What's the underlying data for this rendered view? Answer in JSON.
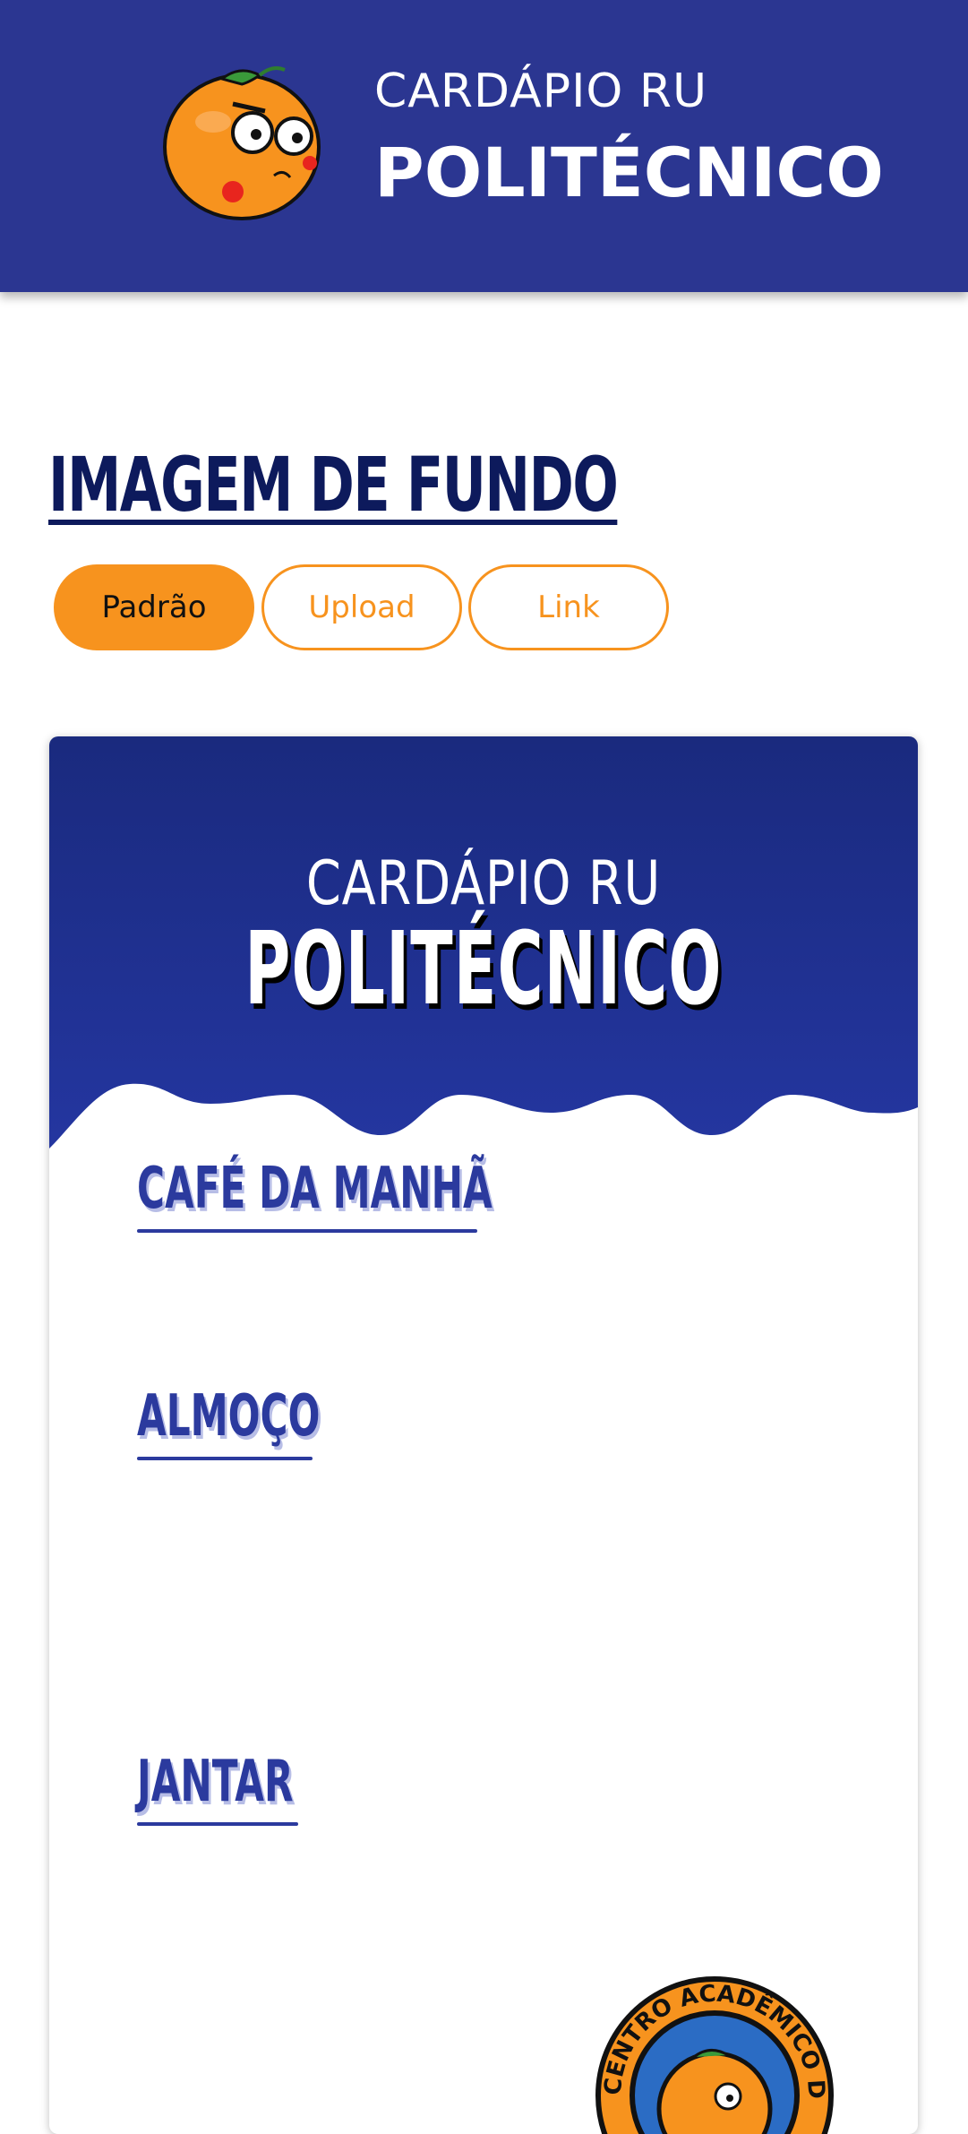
{
  "header": {
    "title_top": "CARDÁPIO RU",
    "title_main": "POLITÉCNICO",
    "logo_icon": "orange-mascot-icon"
  },
  "background_section": {
    "heading": "IMAGEM DE FUNDO",
    "tabs": [
      {
        "label": "Padrão",
        "active": true
      },
      {
        "label": "Upload",
        "active": false
      },
      {
        "label": "Link",
        "active": false
      }
    ]
  },
  "preview": {
    "title_top": "CARDÁPIO RU",
    "title_main": "POLITÉCNICO",
    "meals": [
      {
        "label": "CAFÉ DA MANHÃ"
      },
      {
        "label": "ALMOÇO"
      },
      {
        "label": "JANTAR"
      }
    ],
    "badge_text": "CENTRO ACADÊMICO DE QUÍMICA"
  },
  "colors": {
    "header_bg": "#2b3691",
    "accent_orange": "#f7931e",
    "heading_navy": "#0d1a5c",
    "meal_blue": "#2b3a9e"
  }
}
